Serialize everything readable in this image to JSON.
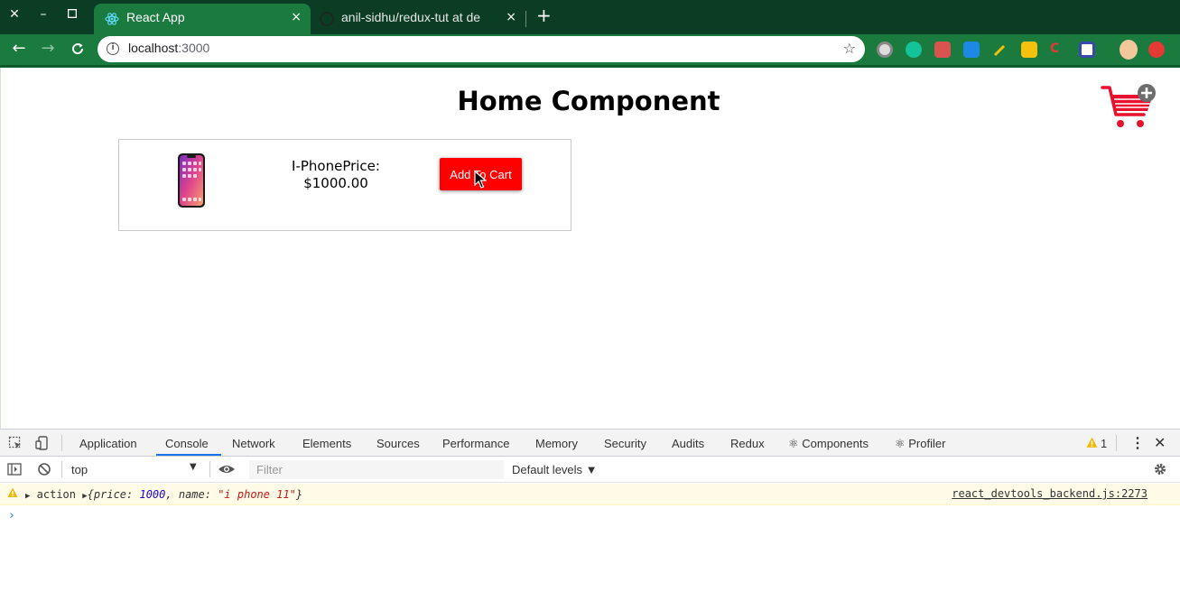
{
  "browser": {
    "tabs": [
      {
        "title": "React App",
        "active": true
      },
      {
        "title": "anil-sidhu/redux-tut at de",
        "active": false
      }
    ],
    "new_tab_glyph": "+",
    "close_glyph": "×",
    "url_host": "localhost",
    "url_port": ":3000",
    "colors": {
      "frame": "#0b3d24",
      "toolbar": "#1b7a3e"
    }
  },
  "page": {
    "heading": "Home Component",
    "product": {
      "name_price": "I-PhonePrice:",
      "price_value": "$1000.00",
      "add_to_cart_label": "Add To Cart"
    },
    "colors": {
      "button": "#ff0000",
      "cart": "#e8112d"
    }
  },
  "devtools": {
    "tabs": [
      "Application",
      "Console",
      "Network",
      "Elements",
      "Sources",
      "Performance",
      "Memory",
      "Security",
      "Audits",
      "Redux",
      "⚛ Components",
      "⚛ Profiler"
    ],
    "active_tab": "Console",
    "warning_count": "1",
    "context": "top",
    "filter_placeholder": "Filter",
    "levels": "Default levels ▼",
    "log": {
      "label": "action",
      "obj_open": "{",
      "price_key": "price: ",
      "price_value": "1000",
      "sep": ", ",
      "name_key": "name: ",
      "name_value": "\"i phone 11\"",
      "obj_close": "}",
      "source": "react_devtools_backend.js:2273"
    },
    "prompt_glyph": "›"
  }
}
